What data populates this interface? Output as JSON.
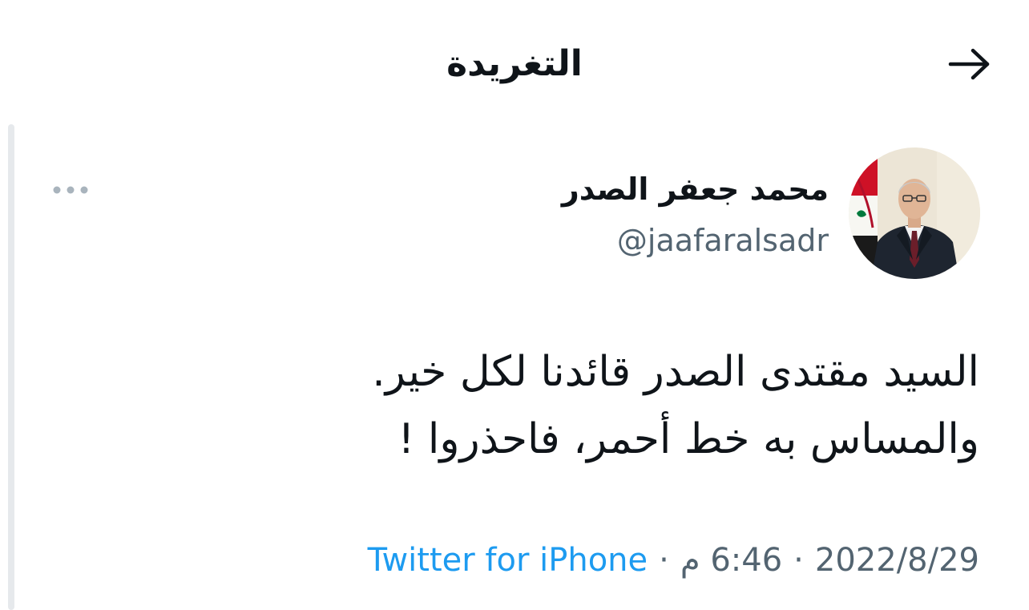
{
  "header": {
    "title": "التغريدة",
    "back_icon": "arrow-right-icon"
  },
  "tweet": {
    "author": {
      "name": "محمد جعفر الصدر",
      "handle": "@jaafaralsadr",
      "avatar_icon": "profile-photo"
    },
    "more_icon": "more-dots-icon",
    "text_lines": [
      "السيد مقتدى الصدر قائدنا لكل خير.",
      "والمساس به خط أحمر، فاحذروا !"
    ],
    "meta": {
      "date": "2022/8/29",
      "separator": "·",
      "time": "6:46 م",
      "source": "Twitter for iPhone"
    }
  },
  "colors": {
    "text_primary": "#0f1419",
    "text_secondary": "#536471",
    "link": "#1d9bf0",
    "flag_red": "#ce1126",
    "flag_green": "#007a3d"
  }
}
